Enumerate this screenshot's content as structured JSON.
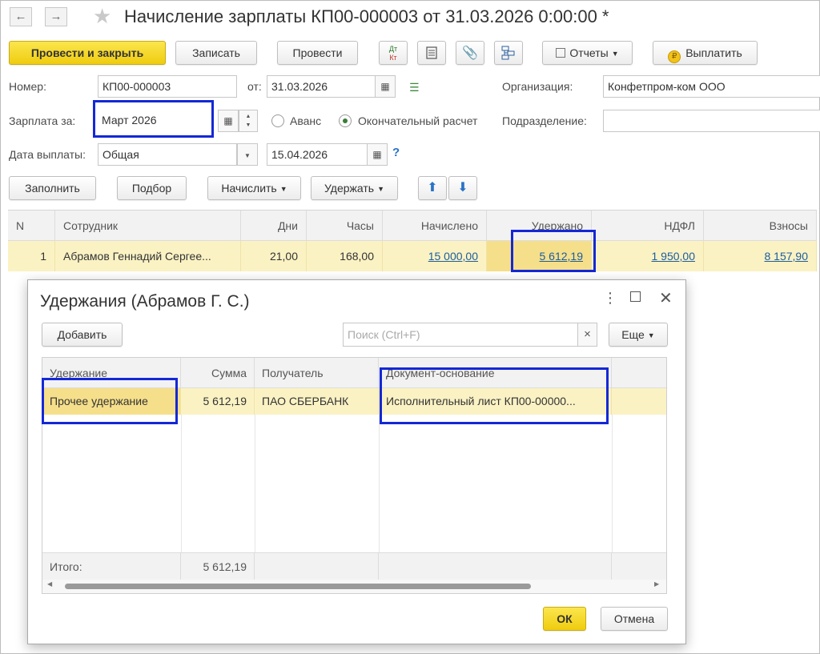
{
  "window": {
    "title": "Начисление зарплаты КП00-000003 от 31.03.2026 0:00:00 *",
    "nav_back": "←",
    "nav_forward": "→"
  },
  "toolbar": {
    "post_close": "Провести и закрыть",
    "save": "Записать",
    "post": "Провести",
    "dt_kt_top": "Дт",
    "dt_kt_bottom": "Кт",
    "reports": "Отчеты",
    "pay": "Выплатить"
  },
  "form": {
    "number_label": "Номер:",
    "number_value": "КП00-000003",
    "date_label": "от:",
    "date_value": "31.03.2026",
    "org_label": "Организация:",
    "org_value": "Конфетпром-ком ООО",
    "salary_for_label": "Зарплата за:",
    "salary_for_value": "Март 2026",
    "advance_label": "Аванс",
    "final_label": "Окончательный расчет",
    "division_label": "Подразделение:",
    "division_value": "",
    "pay_date_label": "Дата выплаты:",
    "pay_type_value": "Общая",
    "pay_date_value": "15.04.2026",
    "help": "?"
  },
  "actions": {
    "fill": "Заполнить",
    "pick": "Подбор",
    "accrue": "Начислить",
    "deduct": "Удержать"
  },
  "grid": {
    "columns": [
      "N",
      "Сотрудник",
      "Дни",
      "Часы",
      "Начислено",
      "Удержано",
      "НДФЛ",
      "Взносы"
    ],
    "rows": [
      {
        "n": "1",
        "employee": "Абрамов Геннадий Сергее...",
        "days": "21,00",
        "hours": "168,00",
        "accrued": "15 000,00",
        "withheld": "5 612,19",
        "ndfl": "1 950,00",
        "contrib": "8 157,90"
      }
    ]
  },
  "modal": {
    "title": "Удержания (Абрамов Г. С.)",
    "add": "Добавить",
    "search_placeholder": "Поиск (Ctrl+F)",
    "clear": "×",
    "more": "Еще",
    "columns": [
      "Удержание",
      "Сумма",
      "Получатель",
      "Документ-основание"
    ],
    "rows": [
      {
        "deduction": "Прочее удержание",
        "amount": "5 612,19",
        "recipient": "ПАО СБЕРБАНК",
        "basis": "Исполнительный лист КП00-00000..."
      }
    ],
    "total_label": "Итого:",
    "total_value": "5 612,19",
    "ok": "ОК",
    "cancel": "Отмена"
  },
  "colors": {
    "primary_button": "#f2d21c",
    "row_highlight": "#fbf2c4",
    "annotation_border": "#1428d6",
    "link": "#1c5d9c"
  }
}
